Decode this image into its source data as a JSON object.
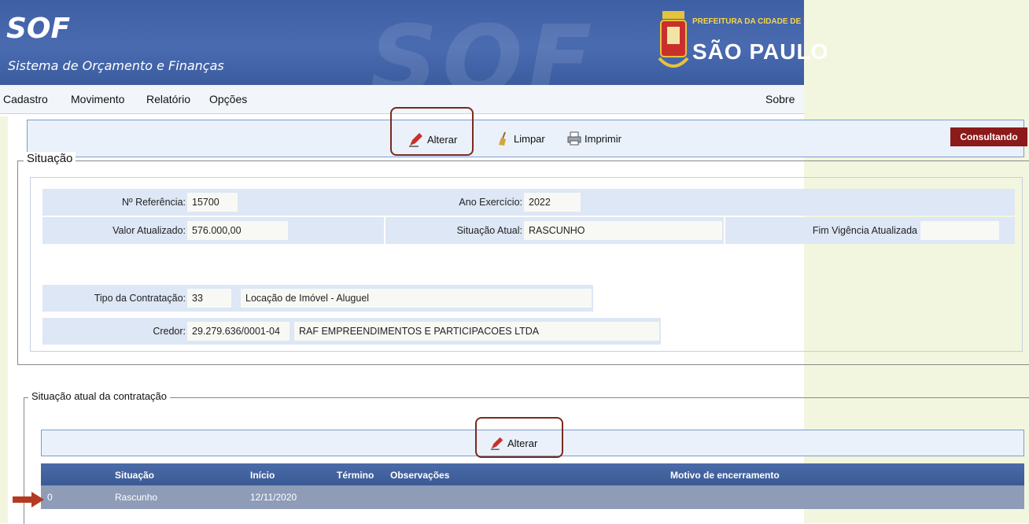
{
  "header": {
    "logo_title": "SOF",
    "logo_subtitle": "Sistema de Orçamento e Finanças",
    "watermark": "SOF",
    "prefeitura_small": "PREFEITURA DA CIDADE DE",
    "prefeitura_big": "SÃO PAULO"
  },
  "menu": {
    "items": [
      "Cadastro",
      "Movimento",
      "Relatório",
      "Opções"
    ],
    "about": "Sobre"
  },
  "toolbar": {
    "alterar": "Alterar",
    "limpar": "Limpar",
    "imprimir": "Imprimir",
    "status": "Consultando"
  },
  "situacao": {
    "legend": "Situação",
    "n_referencia_label": "Nº Referência:",
    "n_referencia_value": "15700",
    "ano_exercicio_label": "Ano Exercício:",
    "ano_exercicio_value": "2022",
    "valor_atualizado_label": "Valor Atualizado:",
    "valor_atualizado_value": "576.000,00",
    "situacao_atual_label": "Situação Atual:",
    "situacao_atual_value": "RASCUNHO",
    "fim_vigencia_label": "Fim Vigência Atualizada",
    "fim_vigencia_value": "",
    "tipo_contratacao_label": "Tipo da Contratação:",
    "tipo_contratacao_code": "33",
    "tipo_contratacao_desc": "Locação de Imóvel - Aluguel",
    "credor_label": "Credor:",
    "credor_cnpj": "29.279.636/0001-04",
    "credor_name": "RAF EMPREENDIMENTOS E PARTICIPACOES LTDA"
  },
  "situacao_atual": {
    "legend": "Situação atual da contratação",
    "alterar": "Alterar",
    "columns": [
      "Situação",
      "Início",
      "Término",
      "Observações",
      "Motivo de encerramento"
    ],
    "rows": [
      {
        "selector": "0",
        "situacao": "Rascunho",
        "inicio": "12/11/2020",
        "termino": "",
        "observacoes": "",
        "motivo": ""
      }
    ]
  },
  "colors": {
    "header_blue": "#3f5fa4",
    "status_badge": "#8b1a1a",
    "highlight_border": "#7b2a1e",
    "arrow": "#b53a22"
  }
}
